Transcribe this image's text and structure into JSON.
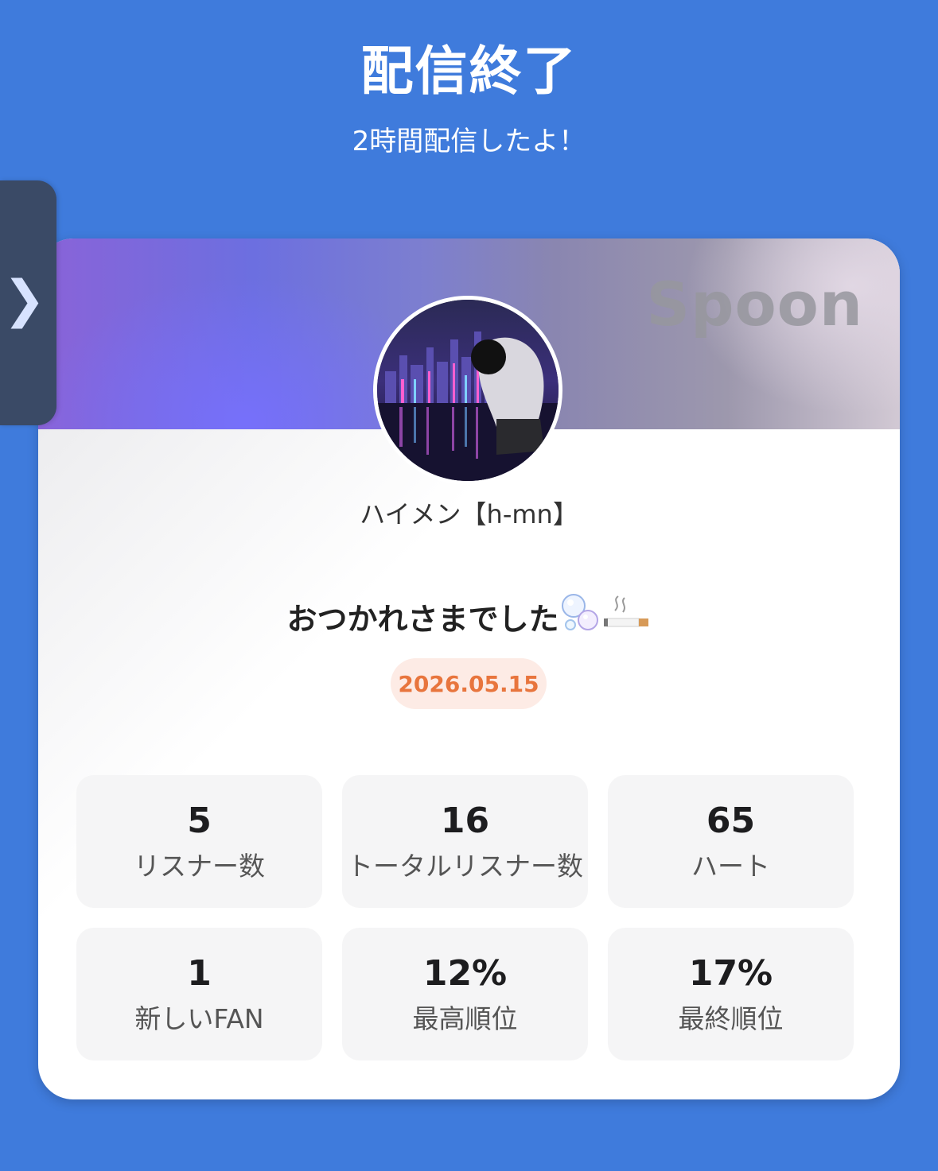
{
  "header": {
    "title": "配信終了",
    "subtitle": "2時間配信したよ！"
  },
  "side_tab": {
    "icon": "chevron-right-icon",
    "glyph": "❯"
  },
  "card": {
    "brand": "Spoon",
    "avatar_icon": "user-avatar",
    "username": "ハイメン【h-mn】",
    "message": "おつかれさまでした",
    "message_emojis": [
      "bubbles-icon",
      "cigarette-icon"
    ],
    "date": "2026.05.15",
    "colors": {
      "accent_date": "#e8753d",
      "date_badge_bg": "#fdebe5",
      "page_bg": "#3f7bdc"
    }
  },
  "stats": [
    {
      "value": "5",
      "label": "リスナー数"
    },
    {
      "value": "16",
      "label": "トータルリスナー数"
    },
    {
      "value": "65",
      "label": "ハート"
    },
    {
      "value": "1",
      "label": "新しいFAN"
    },
    {
      "value": "12%",
      "label": "最高順位"
    },
    {
      "value": "17%",
      "label": "最終順位"
    }
  ]
}
